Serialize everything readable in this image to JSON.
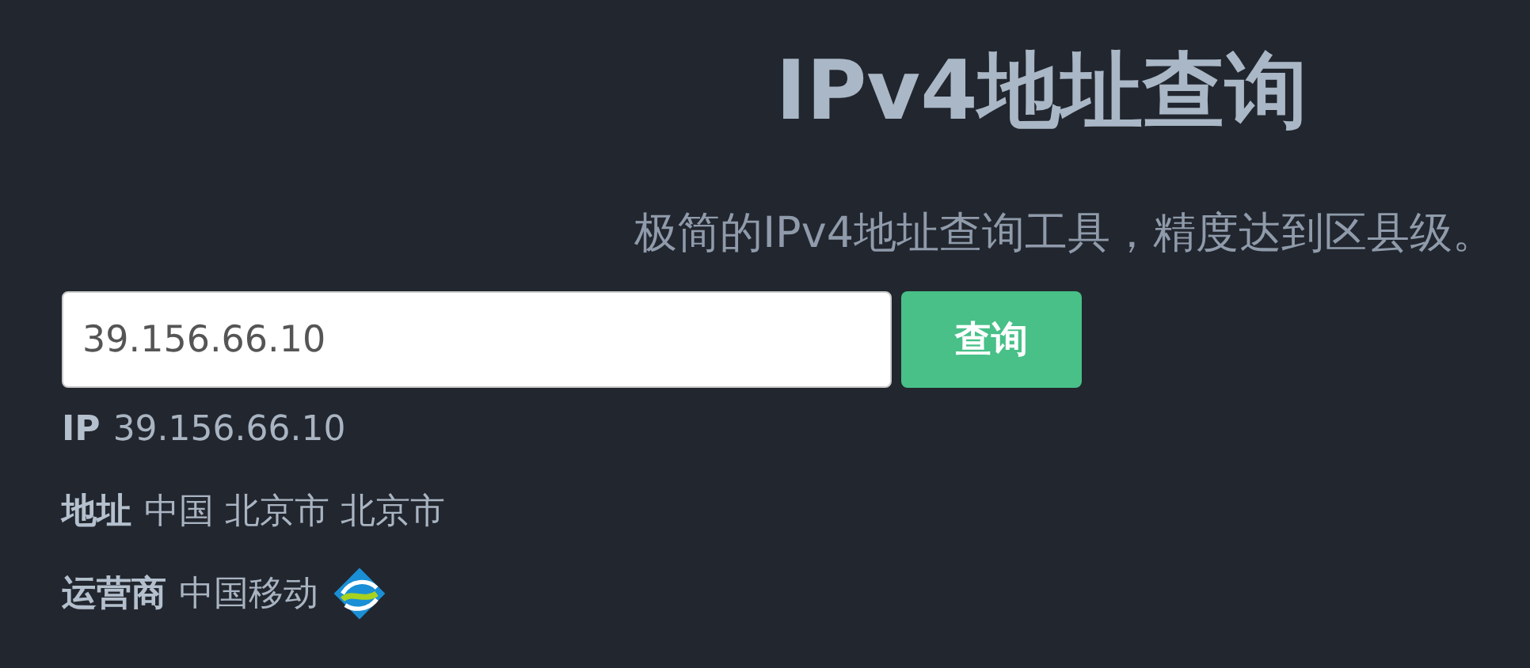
{
  "title": "IPv4地址查询",
  "subtitle": "极简的IPv4地址查询工具，精度达到区县级。",
  "search": {
    "value": "39.156.66.10",
    "button": "查询"
  },
  "results": [
    {
      "kind": "text",
      "label": "IP",
      "value": "39.156.66.10"
    },
    {
      "kind": "text",
      "label": "地址",
      "value": "中国 北京市 北京市"
    },
    {
      "kind": "carrier",
      "label": "运营商",
      "value": "中国移动"
    }
  ]
}
